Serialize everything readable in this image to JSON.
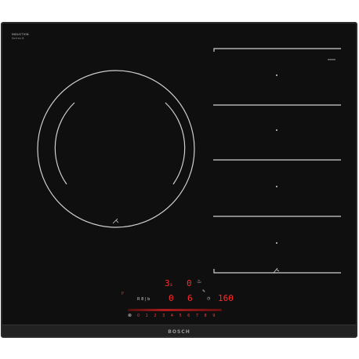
{
  "cooktop": {
    "brand_text_line1": "INDUCTION",
    "brand_text_line2": "Series 8",
    "bottom_brand": "BOSCH"
  },
  "controls": {
    "display_top_left": "3",
    "display_top_left_suffix": "s",
    "display_top_right": "0",
    "display_mid_left": "0",
    "display_mid_right": "6",
    "display_temp": "160",
    "power_label": "P",
    "ctrl_small_text": "R 8 | b",
    "scale_digits": [
      "0",
      "1",
      "2",
      "3",
      "4",
      "5",
      "6",
      "7",
      "8",
      "9"
    ]
  },
  "colors": {
    "glass": "#0f0f0f",
    "frame": "#2b2b2b",
    "display_red": "#ff2a2a",
    "zone_lines": "#d0d0d0"
  }
}
